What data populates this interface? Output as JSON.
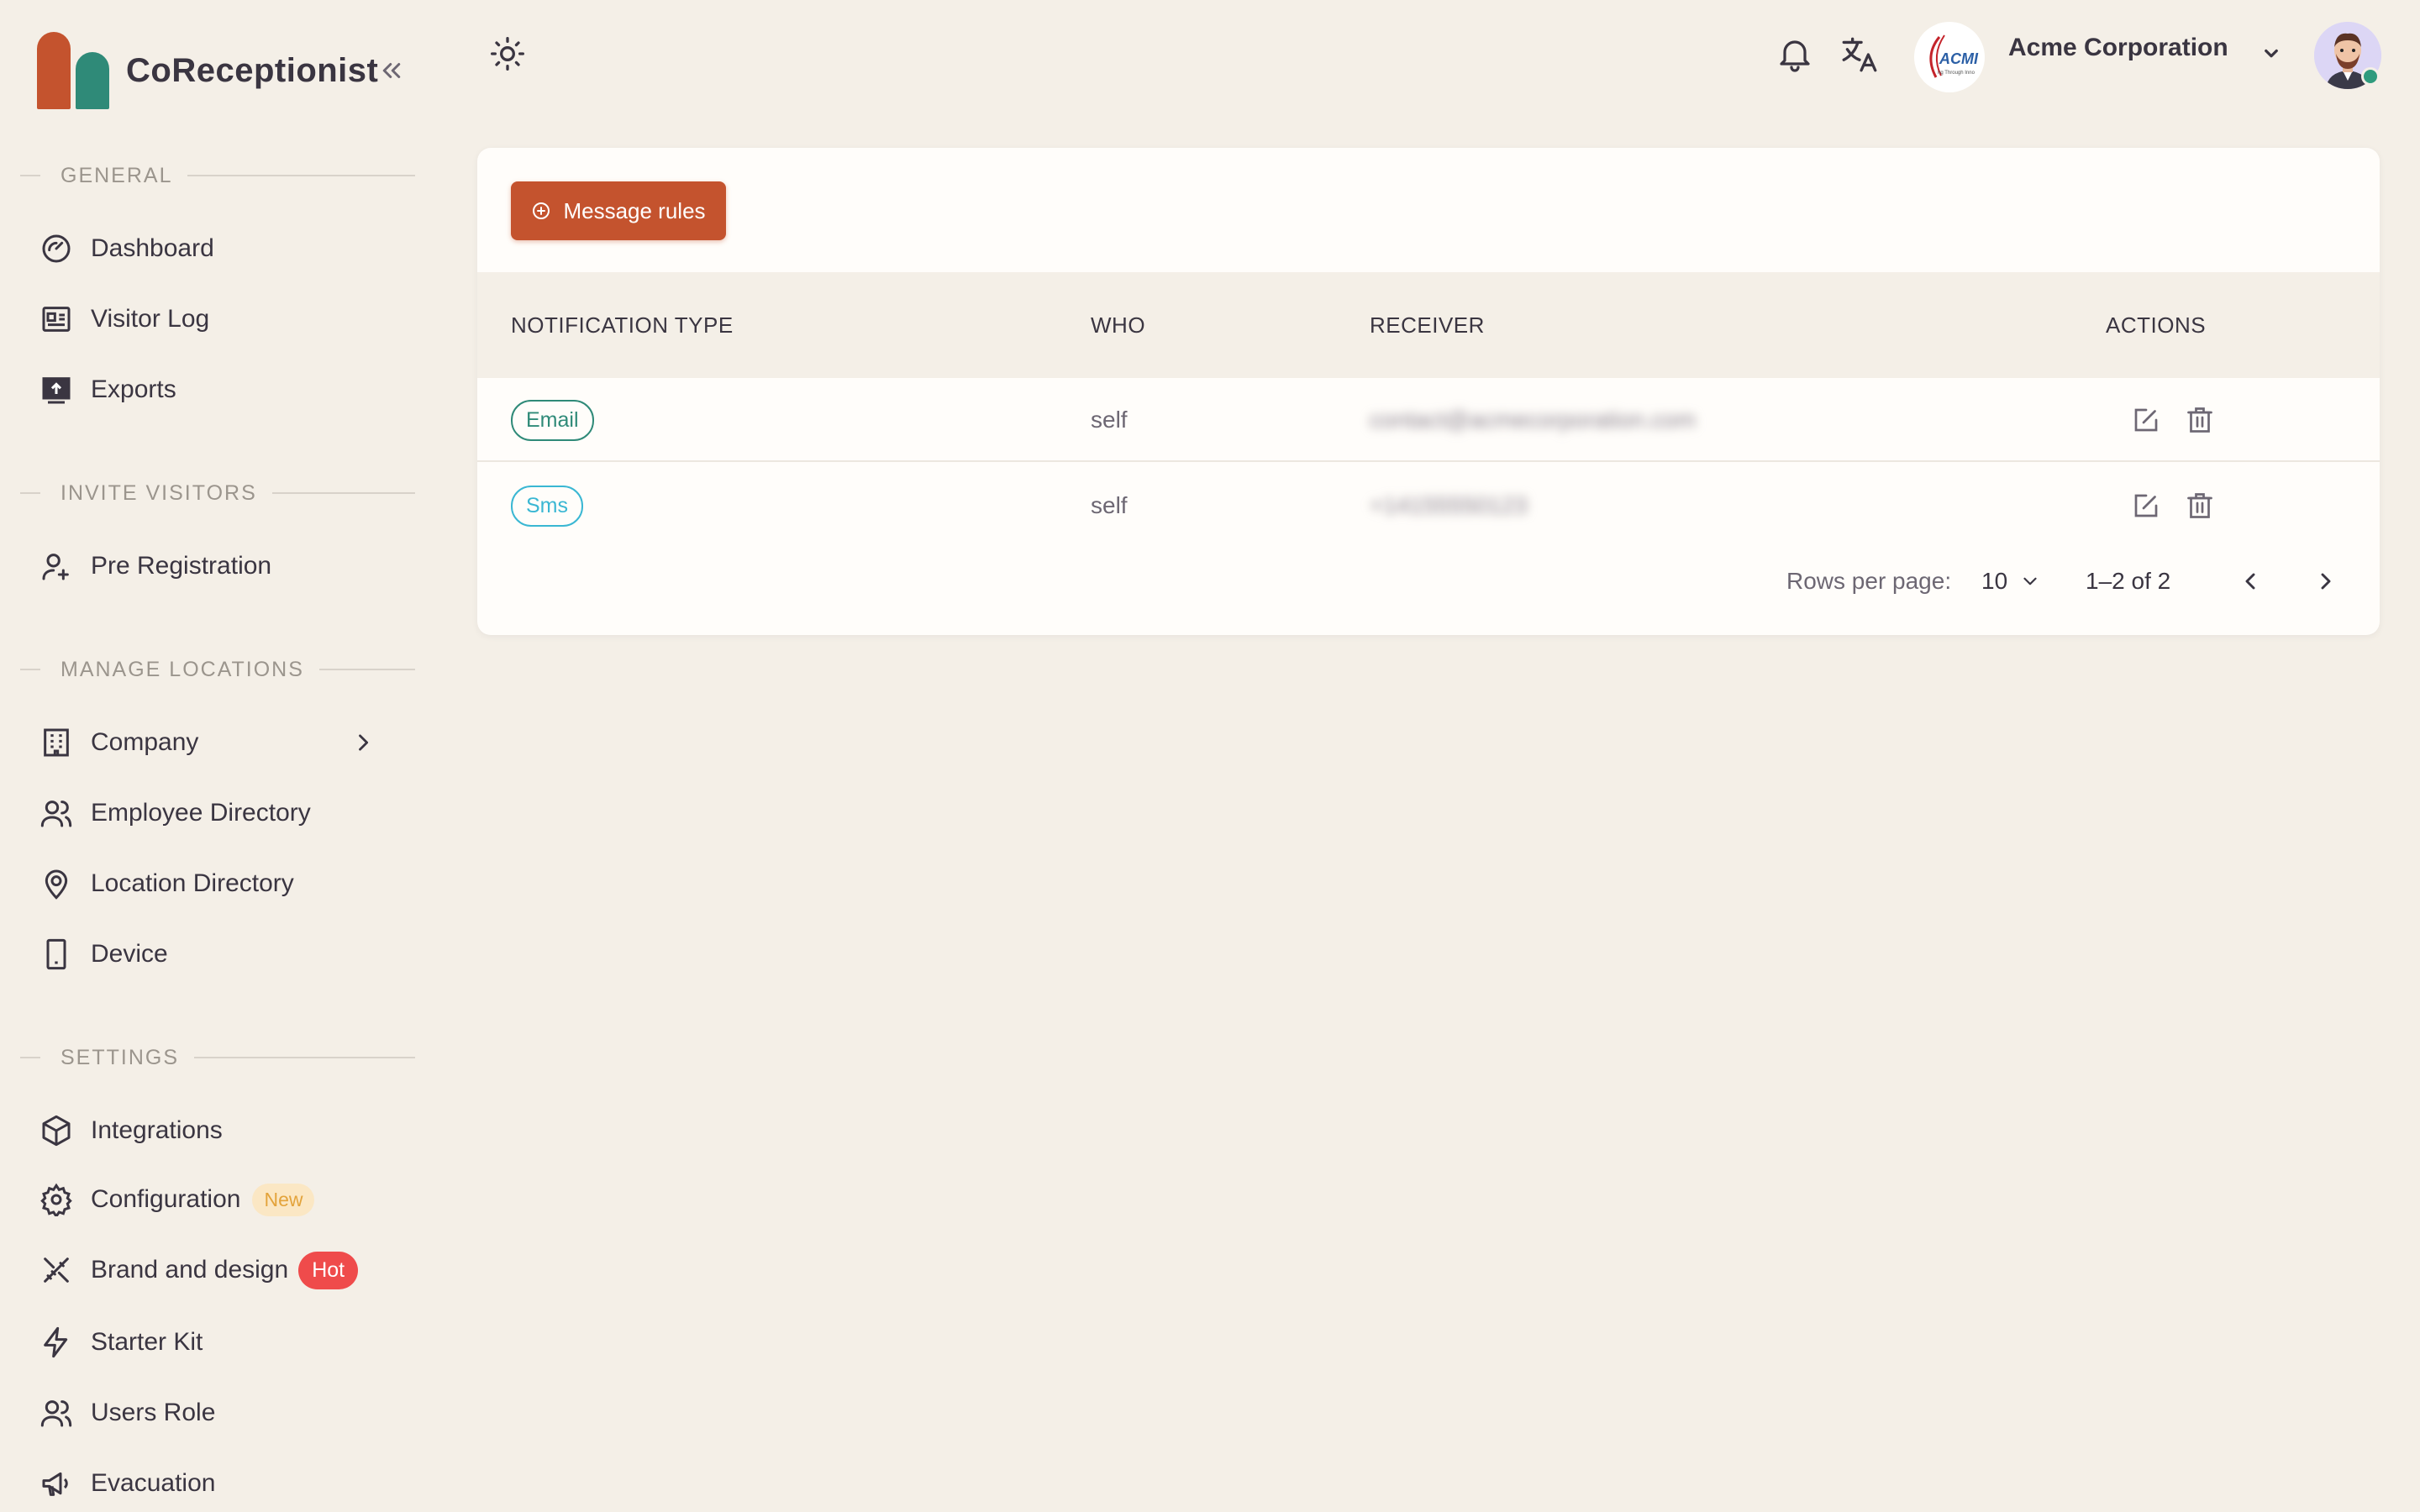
{
  "app": {
    "name": "CoReceptionist"
  },
  "sidebar": {
    "sections": [
      {
        "label": "GENERAL"
      },
      {
        "label": "INVITE VISITORS"
      },
      {
        "label": "MANAGE LOCATIONS"
      },
      {
        "label": "SETTINGS"
      }
    ],
    "items": [
      {
        "label": "Dashboard",
        "icon": "gauge-icon"
      },
      {
        "label": "Visitor Log",
        "icon": "id-card-icon"
      },
      {
        "label": "Exports",
        "icon": "export-icon"
      },
      {
        "label": "Pre Registration",
        "icon": "user-plus-icon"
      },
      {
        "label": "Company",
        "icon": "building-icon"
      },
      {
        "label": "Employee Directory",
        "icon": "users-icon"
      },
      {
        "label": "Location Directory",
        "icon": "map-pin-icon"
      },
      {
        "label": "Device",
        "icon": "device-icon"
      },
      {
        "label": "Integrations",
        "icon": "cube-icon"
      },
      {
        "label": "Configuration",
        "icon": "gear-icon",
        "badge": "New"
      },
      {
        "label": "Brand and design",
        "icon": "design-tools-icon",
        "badge": "Hot"
      },
      {
        "label": "Starter Kit",
        "icon": "bolt-icon"
      },
      {
        "label": "Users Role",
        "icon": "users-role-icon"
      },
      {
        "label": "Evacuation",
        "icon": "megaphone-icon"
      }
    ]
  },
  "topbar": {
    "company_name": "Acme Corporation",
    "company_logo_text": "ACMI",
    "company_logo_tagline": "ng Through Inno"
  },
  "main": {
    "add_button_label": "Message rules",
    "table": {
      "columns": [
        "NOTIFICATION TYPE",
        "WHO",
        "RECEIVER",
        "ACTIONS"
      ],
      "rows": [
        {
          "type": "Email",
          "who": "self",
          "receiver": "contact@acmecorporation.com"
        },
        {
          "type": "Sms",
          "who": "self",
          "receiver": "+14155550123"
        }
      ]
    },
    "pagination": {
      "rows_per_page_label": "Rows per page:",
      "rows_per_page": "10",
      "range": "1–2 of 2"
    }
  },
  "colors": {
    "accent": "#c4532e",
    "teal": "#2f8a78",
    "sms": "#3ab7d3",
    "background": "#f4efe7",
    "hot": "#ef4b4b"
  }
}
